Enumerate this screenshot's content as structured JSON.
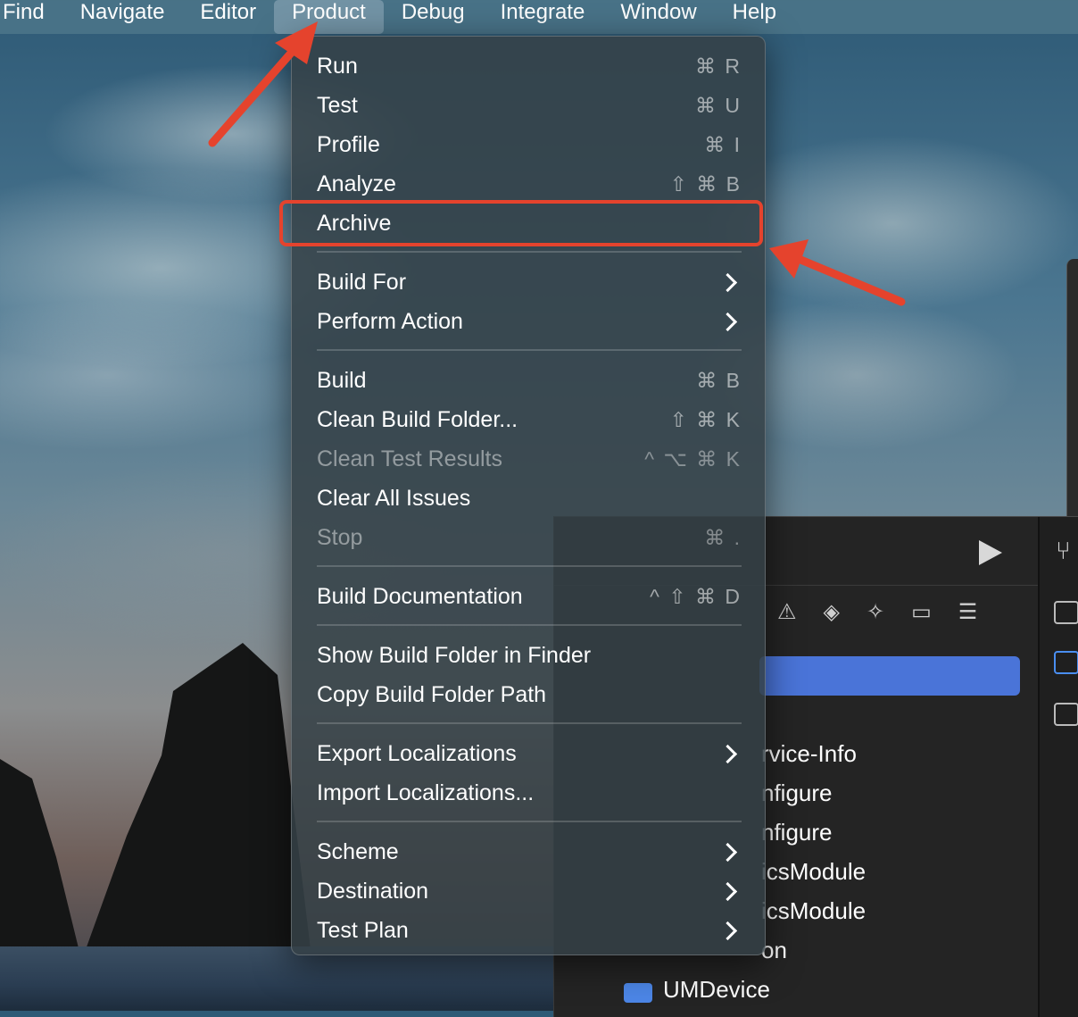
{
  "menubar": {
    "items": [
      "Find",
      "Navigate",
      "Editor",
      "Product",
      "Debug",
      "Integrate",
      "Window",
      "Help"
    ],
    "active": "Product"
  },
  "menu": {
    "items": [
      {
        "label": "Run",
        "shortcut": "⌘ R"
      },
      {
        "label": "Test",
        "shortcut": "⌘ U"
      },
      {
        "label": "Profile",
        "shortcut": "⌘ I"
      },
      {
        "label": "Analyze",
        "shortcut": "⇧ ⌘ B"
      },
      {
        "label": "Archive",
        "shortcut": ""
      },
      {
        "label": "Build For",
        "submenu": true
      },
      {
        "label": "Perform Action",
        "submenu": true
      },
      {
        "label": "Build",
        "shortcut": "⌘ B"
      },
      {
        "label": "Clean Build Folder...",
        "shortcut": "⇧ ⌘ K"
      },
      {
        "label": "Clean Test Results",
        "shortcut": "^ ⌥ ⌘ K",
        "disabled": true
      },
      {
        "label": "Clear All Issues",
        "shortcut": ""
      },
      {
        "label": "Stop",
        "shortcut": "⌘ .",
        "disabled": true
      },
      {
        "label": "Build Documentation",
        "shortcut": "^ ⇧ ⌘ D"
      },
      {
        "label": "Show Build Folder in Finder",
        "shortcut": ""
      },
      {
        "label": "Copy Build Folder Path",
        "shortcut": ""
      },
      {
        "label": "Export Localizations",
        "submenu": true
      },
      {
        "label": "Import Localizations...",
        "shortcut": ""
      },
      {
        "label": "Scheme",
        "submenu": true
      },
      {
        "label": "Destination",
        "submenu": true
      },
      {
        "label": "Test Plan",
        "submenu": true
      }
    ]
  },
  "xcode": {
    "files": [
      "rvice-Info",
      "nfigure",
      "nfigure",
      "icsModule",
      "icsModule",
      "on"
    ],
    "packages": [
      "UMDevice"
    ],
    "icons": [
      "play-icon",
      "branch-icon",
      "warning-icon",
      "diamond-icon",
      "test-icon",
      "tag-icon",
      "list-icon"
    ],
    "accent": "#4a74d8"
  },
  "annotation": {
    "color": "#e5432d"
  }
}
